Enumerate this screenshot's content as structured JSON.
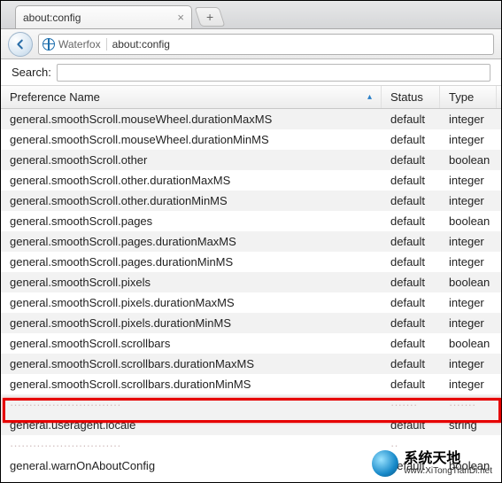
{
  "tab": {
    "title": "about:config"
  },
  "nav": {
    "site_identity": "Waterfox",
    "url": "about:config"
  },
  "search": {
    "label": "Search:",
    "value": ""
  },
  "columns": {
    "name": "Preference Name",
    "status": "Status",
    "type": "Type"
  },
  "rows": [
    {
      "name": "general.smoothScroll.mouseWheel.durationMaxMS",
      "status": "default",
      "type": "integer"
    },
    {
      "name": "general.smoothScroll.mouseWheel.durationMinMS",
      "status": "default",
      "type": "integer"
    },
    {
      "name": "general.smoothScroll.other",
      "status": "default",
      "type": "boolean"
    },
    {
      "name": "general.smoothScroll.other.durationMaxMS",
      "status": "default",
      "type": "integer"
    },
    {
      "name": "general.smoothScroll.other.durationMinMS",
      "status": "default",
      "type": "integer"
    },
    {
      "name": "general.smoothScroll.pages",
      "status": "default",
      "type": "boolean"
    },
    {
      "name": "general.smoothScroll.pages.durationMaxMS",
      "status": "default",
      "type": "integer"
    },
    {
      "name": "general.smoothScroll.pages.durationMinMS",
      "status": "default",
      "type": "integer"
    },
    {
      "name": "general.smoothScroll.pixels",
      "status": "default",
      "type": "boolean"
    },
    {
      "name": "general.smoothScroll.pixels.durationMaxMS",
      "status": "default",
      "type": "integer"
    },
    {
      "name": "general.smoothScroll.pixels.durationMinMS",
      "status": "default",
      "type": "integer"
    },
    {
      "name": "general.smoothScroll.scrollbars",
      "status": "default",
      "type": "boolean"
    },
    {
      "name": "general.smoothScroll.scrollbars.durationMaxMS",
      "status": "default",
      "type": "integer"
    },
    {
      "name": "general.smoothScroll.scrollbars.durationMinMS",
      "status": "default",
      "type": "integer"
    },
    {
      "name": "general.useragent.locale",
      "status": "default",
      "type": "string"
    },
    {
      "name": "general.warnOnAboutConfig",
      "status": "default",
      "type": "boolean"
    }
  ],
  "highlight_index": 14,
  "watermark": {
    "title": "系统天地",
    "url": "www.XiTongTianDi.net"
  }
}
